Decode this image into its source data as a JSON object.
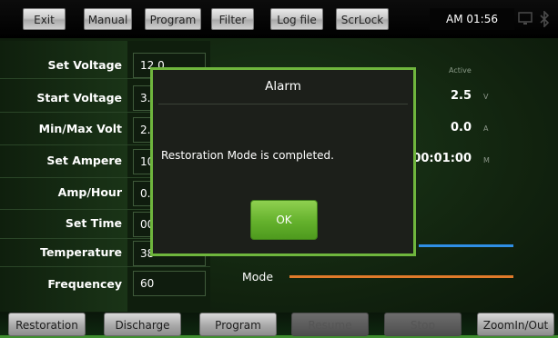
{
  "toolbar": {
    "exit": "Exit",
    "manual": "Manual",
    "program": "Program",
    "filter": "Filter",
    "log_file": "Log file",
    "scrlock": "ScrLock",
    "clock": "AM 01:56"
  },
  "params": [
    {
      "label": "Set Voltage",
      "value": "12.0"
    },
    {
      "label": "Start Voltage",
      "value": "3."
    },
    {
      "label": "Min/Max Volt",
      "value": "2."
    },
    {
      "label": "Set Ampere",
      "value": "10"
    },
    {
      "label": "Amp/Hour",
      "value": "0."
    },
    {
      "label": "Set Time",
      "value": "00"
    },
    {
      "label": "Temperature",
      "value": "38"
    },
    {
      "label": "Frequencey",
      "value": "60"
    }
  ],
  "readouts": {
    "active_label": "Active",
    "voltage": "2.5",
    "voltage_unit": "V",
    "current": "0.0",
    "current_unit": "A",
    "time": "00:01:00",
    "time_unit": "M"
  },
  "legend": {
    "mode": "Mode"
  },
  "colors": {
    "accent_green": "#6fb63d",
    "line_blue": "#2f8fe6",
    "line_orange": "#e07a2a"
  },
  "bottombar": {
    "restoration": "Restoration",
    "discharge": "Discharge",
    "program": "Program",
    "resume": "Resume",
    "stop": "Stop",
    "zoom": "ZoomIn/Out"
  },
  "dialog": {
    "title": "Alarm",
    "message": "Restoration Mode is completed.",
    "ok": "OK"
  }
}
